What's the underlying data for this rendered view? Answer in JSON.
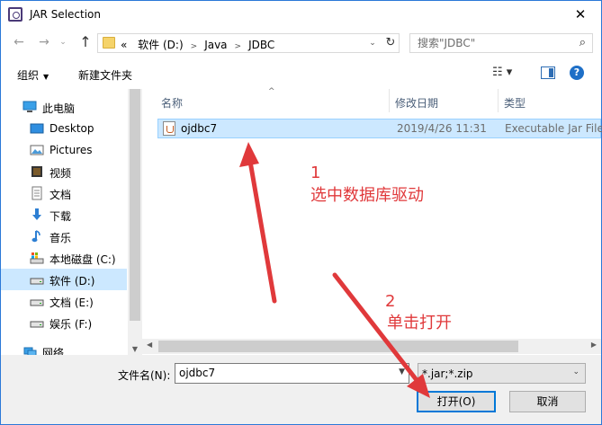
{
  "window": {
    "title": "JAR Selection",
    "close_glyph": "✕"
  },
  "nav": {
    "back": "←",
    "forward": "→",
    "recent": "⌄",
    "up": "↑"
  },
  "address": {
    "crumbs": [
      "«",
      "软件 (D:)",
      "Java",
      "JDBC"
    ],
    "dropdown": "⌄",
    "refresh": "↻"
  },
  "search": {
    "placeholder": "搜索\"JDBC\"",
    "icon": "⌕"
  },
  "toolbar": {
    "organize": "组织",
    "organize_caret": "▼",
    "new_folder": "新建文件夹",
    "view": "☷ ▾",
    "help": "?"
  },
  "sidebar": {
    "items": [
      {
        "label": "此电脑",
        "icon": "pc-icon"
      },
      {
        "label": "Desktop",
        "icon": "desktop-icon"
      },
      {
        "label": "Pictures",
        "icon": "pictures-icon"
      },
      {
        "label": "视频",
        "icon": "video-icon"
      },
      {
        "label": "文档",
        "icon": "document-icon"
      },
      {
        "label": "下载",
        "icon": "download-icon"
      },
      {
        "label": "音乐",
        "icon": "music-icon"
      },
      {
        "label": "本地磁盘 (C:)",
        "icon": "drive-icon"
      },
      {
        "label": "软件 (D:)",
        "icon": "drive-icon"
      },
      {
        "label": "文档 (E:)",
        "icon": "drive-icon"
      },
      {
        "label": "娱乐 (F:)",
        "icon": "drive-icon"
      },
      {
        "label": "网络",
        "icon": "network-icon"
      }
    ],
    "selected_index": 8
  },
  "columns": {
    "name": "名称",
    "date": "修改日期",
    "type": "类型",
    "sort_caret": "^"
  },
  "files": [
    {
      "name": "ojdbc7",
      "modified": "2019/4/26 11:31",
      "type": "Executable Jar File"
    }
  ],
  "footer": {
    "filename_label": "文件名(N):",
    "filename_value": "ojdbc7",
    "filetype_value": "*.jar;*.zip",
    "open_label": "打开(O)",
    "cancel_label": "取消"
  },
  "annotations": {
    "step1_num": "1",
    "step1_text": "选中数据库驱动",
    "step2_num": "2",
    "step2_text": "单击打开",
    "color": "#e0393b"
  }
}
